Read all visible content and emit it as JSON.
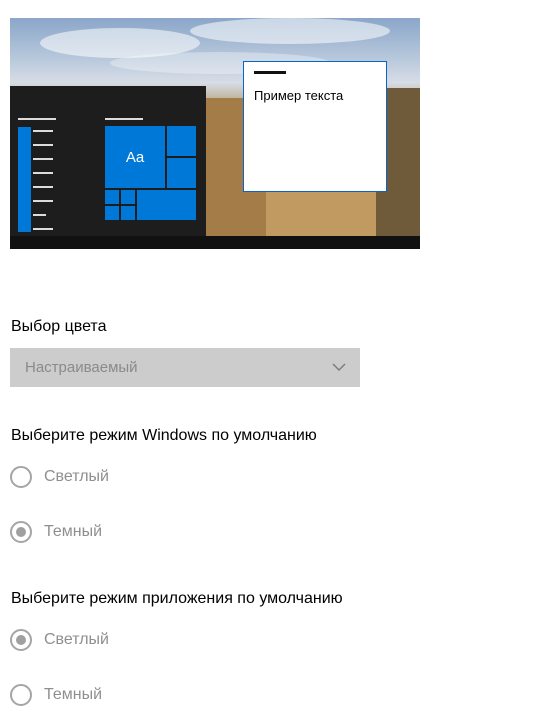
{
  "preview": {
    "tile_label": "Aa",
    "sample_text": "Пример текста"
  },
  "color_choice": {
    "label": "Выбор цвета",
    "selected_value": "Настраиваемый"
  },
  "windows_mode": {
    "label": "Выберите режим Windows по умолчанию",
    "options": [
      {
        "label": "Светлый",
        "selected": false
      },
      {
        "label": "Темный",
        "selected": true
      }
    ]
  },
  "app_mode": {
    "label": "Выберите режим приложения по умолчанию",
    "options": [
      {
        "label": "Светлый",
        "selected": true
      },
      {
        "label": "Темный",
        "selected": false
      }
    ]
  }
}
